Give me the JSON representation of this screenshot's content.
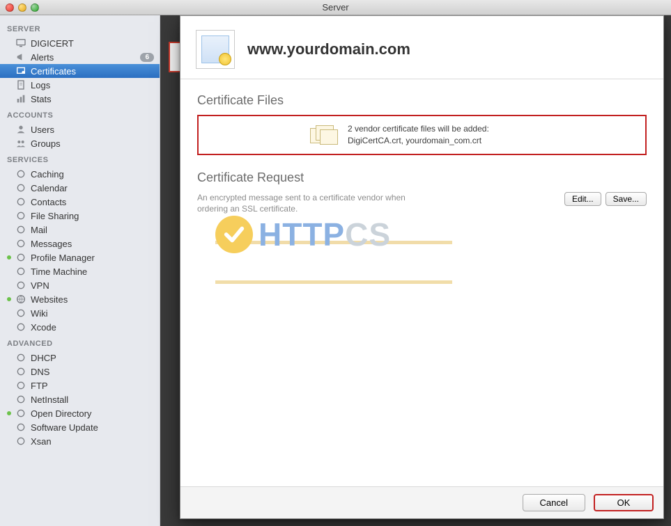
{
  "window": {
    "title": "Server"
  },
  "sidebar": {
    "sections": [
      {
        "header": "SERVER",
        "items": [
          {
            "label": "DIGICERT",
            "icon": "monitor-icon"
          },
          {
            "label": "Alerts",
            "icon": "megaphone-icon",
            "badge": "6"
          },
          {
            "label": "Certificates",
            "icon": "certificate-icon",
            "selected": true
          },
          {
            "label": "Logs",
            "icon": "document-icon"
          },
          {
            "label": "Stats",
            "icon": "barchart-icon"
          }
        ]
      },
      {
        "header": "ACCOUNTS",
        "items": [
          {
            "label": "Users",
            "icon": "user-icon"
          },
          {
            "label": "Groups",
            "icon": "group-icon"
          }
        ]
      },
      {
        "header": "SERVICES",
        "items": [
          {
            "label": "Caching",
            "icon": "cache-icon"
          },
          {
            "label": "Calendar",
            "icon": "calendar-icon"
          },
          {
            "label": "Contacts",
            "icon": "contacts-icon"
          },
          {
            "label": "File Sharing",
            "icon": "folder-icon"
          },
          {
            "label": "Mail",
            "icon": "mail-icon"
          },
          {
            "label": "Messages",
            "icon": "messages-icon"
          },
          {
            "label": "Profile Manager",
            "icon": "gear-icon",
            "status": true
          },
          {
            "label": "Time Machine",
            "icon": "clock-icon"
          },
          {
            "label": "VPN",
            "icon": "lock-icon"
          },
          {
            "label": "Websites",
            "icon": "globe-icon",
            "status": true
          },
          {
            "label": "Wiki",
            "icon": "wiki-icon"
          },
          {
            "label": "Xcode",
            "icon": "hammer-icon"
          }
        ]
      },
      {
        "header": "ADVANCED",
        "items": [
          {
            "label": "DHCP",
            "icon": "dhcp-icon"
          },
          {
            "label": "DNS",
            "icon": "dns-icon"
          },
          {
            "label": "FTP",
            "icon": "ftp-icon"
          },
          {
            "label": "NetInstall",
            "icon": "netinstall-icon"
          },
          {
            "label": "Open Directory",
            "icon": "directory-icon",
            "status": true
          },
          {
            "label": "Software Update",
            "icon": "update-icon"
          },
          {
            "label": "Xsan",
            "icon": "xsan-icon"
          }
        ]
      }
    ]
  },
  "sheet": {
    "title": "www.yourdomain.com",
    "files_section": {
      "title": "Certificate Files",
      "line1": "2 vendor certificate files will be added:",
      "line2": "DigiCertCA.crt, yourdomain_com.crt"
    },
    "request_section": {
      "title": "Certificate Request",
      "description": "An encrypted message sent to a certificate vendor when ordering an SSL certificate.",
      "edit_label": "Edit...",
      "save_label": "Save..."
    },
    "watermark": {
      "text_main": "HTTP",
      "text_suffix1": "C",
      "text_suffix2": "S"
    },
    "footer": {
      "cancel": "Cancel",
      "ok": "OK"
    }
  }
}
